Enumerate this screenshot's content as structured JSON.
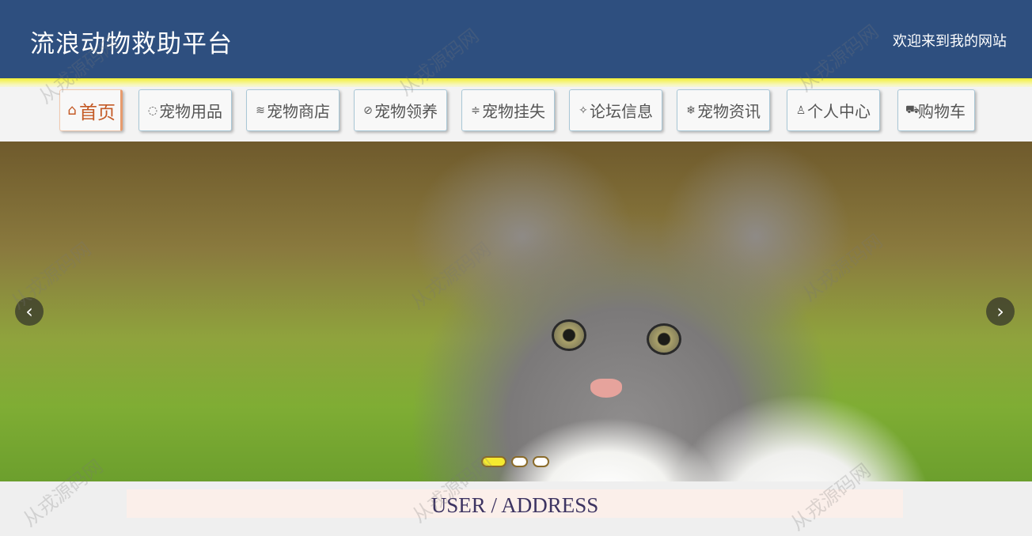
{
  "header": {
    "title": "流浪动物救助平台",
    "welcome": "欢迎来到我的网站"
  },
  "nav": {
    "items": [
      {
        "label": "首页",
        "icon": "home-icon",
        "glyph": "⌂",
        "active": true
      },
      {
        "label": "宠物用品",
        "icon": "palette-icon",
        "glyph": "◌"
      },
      {
        "label": "宠物商店",
        "icon": "layers-icon",
        "glyph": "≋"
      },
      {
        "label": "宠物领养",
        "icon": "tag-icon",
        "glyph": "⊘"
      },
      {
        "label": "宠物挂失",
        "icon": "sliders-icon",
        "glyph": "≑"
      },
      {
        "label": "论坛信息",
        "icon": "sparkle-icon",
        "glyph": "✧"
      },
      {
        "label": "宠物资讯",
        "icon": "snowflake-icon",
        "glyph": "❄"
      },
      {
        "label": "个人中心",
        "icon": "user-icon",
        "glyph": "♙"
      },
      {
        "label": "购物车",
        "icon": "cart-icon",
        "glyph": "⛟"
      }
    ]
  },
  "carousel": {
    "image": "gray-white-kitten-in-grass",
    "prev_icon": "chevron-left-icon",
    "next_icon": "chevron-right-icon",
    "prev_glyph": "‹",
    "next_glyph": "›",
    "slide_count": 3,
    "active_index": 0
  },
  "section": {
    "title": "USER / ADDRESS"
  },
  "watermark": {
    "text": "从戎源码网"
  },
  "colors": {
    "header_bg": "#2e4f7f",
    "active_nav_text": "#c45a26",
    "section_bg": "#fbefea"
  }
}
